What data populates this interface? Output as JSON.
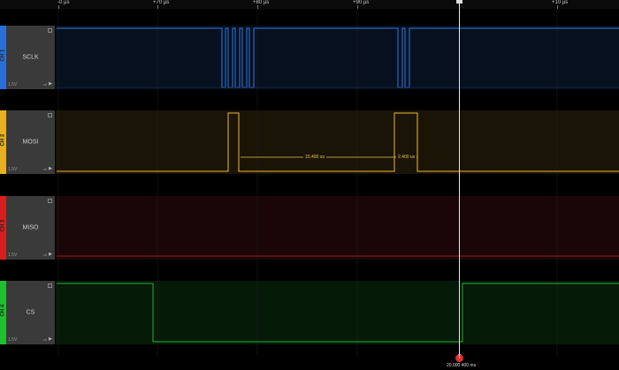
{
  "ruler": {
    "ticks": [
      {
        "label": "-0 µs"
      },
      {
        "label": "+70 µs"
      },
      {
        "label": "+80 µs"
      },
      {
        "label": "+90 µs"
      },
      {
        "label": "+10 µs"
      }
    ],
    "cursor_head_label": "+00"
  },
  "channels": [
    {
      "id": "CH 1",
      "name": "SCLK",
      "volt": "1.5V",
      "color": "#2a6fd6",
      "bg": "#07101e",
      "line": "#2f7ae8"
    },
    {
      "id": "CH 2",
      "name": "MOSI",
      "volt": "1.5V",
      "color": "#e8b020",
      "bg": "#1a1407",
      "line": "#f0b830"
    },
    {
      "id": "CH 3",
      "name": "MISO",
      "volt": "1.5V",
      "color": "#d62020",
      "bg": "#1a0608",
      "line": "#a01818"
    },
    {
      "id": "CH 4",
      "name": "CS",
      "volt": "1.5V",
      "color": "#20c030",
      "bg": "#061a08",
      "line": "#20b030"
    }
  ],
  "measurements": {
    "width1": "15.400 us",
    "width2": "2.400 us"
  },
  "cursor": {
    "marker": "T",
    "time": "20.000 400 ms"
  },
  "icons": {
    "settings": "gear-icon",
    "expand": "play-arrow-icon"
  }
}
